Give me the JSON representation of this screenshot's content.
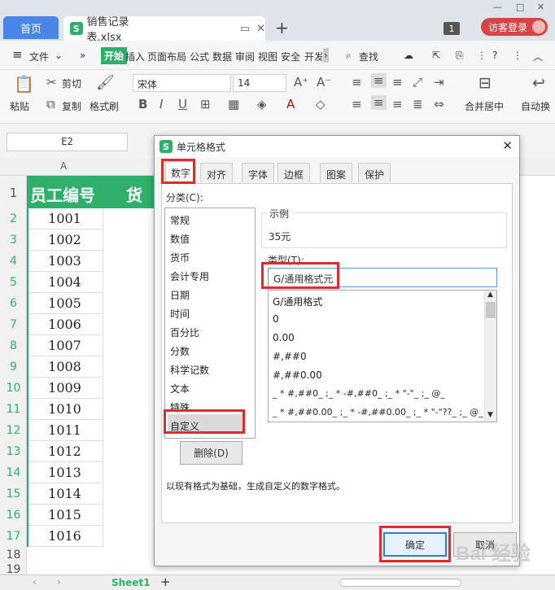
{
  "titlebar": {
    "home_tab": "首页",
    "file_tab": "销售记录表.xlsx",
    "window_count": "1",
    "visitor_login": "访客登录"
  },
  "menu": {
    "file": "文件",
    "items": [
      "开始",
      "插入",
      "页面布局",
      "公式",
      "数据",
      "审阅",
      "视图",
      "安全",
      "开发"
    ],
    "search": "查找"
  },
  "ribbon": {
    "paste": "粘贴",
    "cut": "剪切",
    "copy": "复制",
    "format_painter": "格式刷",
    "font_name": "宋体",
    "font_size": "14",
    "merge_center": "合并居中",
    "auto_wrap": "自动换"
  },
  "formula_bar": {
    "name_box": "E2"
  },
  "sheet": {
    "col_a": "A",
    "header_a": "员工编号",
    "header_b": "货物",
    "row_numbers": [
      "1",
      "2",
      "3",
      "4",
      "5",
      "6",
      "7",
      "8",
      "9",
      "10",
      "11",
      "12",
      "13",
      "14",
      "15",
      "16",
      "17",
      "18",
      "19"
    ],
    "values": [
      "1001",
      "1002",
      "1003",
      "1004",
      "1005",
      "1006",
      "1007",
      "1008",
      "1009",
      "1010",
      "1011",
      "1012",
      "1013",
      "1014",
      "1015",
      "1016"
    ],
    "sheet_tab": "Sheet1"
  },
  "dialog": {
    "title": "单元格格式",
    "tabs": [
      "数字",
      "对齐",
      "字体",
      "边框",
      "图案",
      "保护"
    ],
    "category_label": "分类(C):",
    "categories": [
      "常规",
      "数值",
      "货币",
      "会计专用",
      "日期",
      "时间",
      "百分比",
      "分数",
      "科学记数",
      "文本",
      "特殊",
      "自定义"
    ],
    "sample_label": "示例",
    "sample_value": "35元",
    "type_label": "类型(T):",
    "type_value": "G/通用格式元",
    "formats": [
      "G/通用格式",
      "0",
      "0.00",
      "#,##0",
      "#,##0.00",
      "_ * #,##0_ ;_ * -#,##0_ ;_ * \"-\"_ ;_ @_",
      "_ * #,##0.00_ ;_ * -#,##0.00_ ;_ * \"-\"??_ ;_ @_"
    ],
    "delete_button": "删除(D)",
    "description": "以现有格式为基础，生成自定义的数字格式。",
    "ok_button": "确定",
    "cancel_button": "取消"
  },
  "colors": {
    "accent_green": "#2eb06a",
    "highlight_red": "#e12b2b",
    "home_blue": "#4a86e8"
  }
}
